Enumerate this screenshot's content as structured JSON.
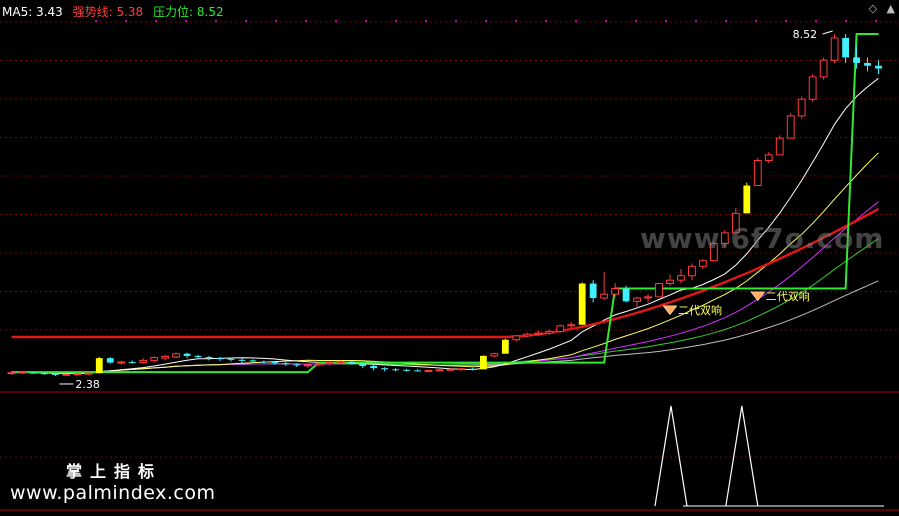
{
  "legend": {
    "ma5_label": "MA5: 3.43",
    "strong_label": "强势线: 5.38",
    "pressure_label": "压力位: 8.52"
  },
  "controls": {
    "diamond": "◇",
    "up": "▲"
  },
  "price_labels": {
    "high": "8.52",
    "low": "2.38"
  },
  "signal_label": "二代双响",
  "watermark": "www.6f7o.com",
  "footer": {
    "chinese": "掌上指标",
    "site": "www.palmindex.com"
  },
  "colors": {
    "up": "#ff3b3b",
    "down": "#3ff0ff",
    "limit_up": "#ffff00",
    "strong": "#e01818",
    "pressure": "#33e833",
    "ma_white": "#ffffff",
    "ma_yellow": "#ffff66",
    "ma_magenta": "#d030ff",
    "ma_green": "#33cc33",
    "ma_gray": "#c0c0c0",
    "grid": "#7a0000",
    "dots": "#c000c0"
  },
  "chart_data": {
    "type": "candlestick",
    "series_count": 80,
    "y_range": [
      2.2,
      8.7
    ],
    "candles": [
      [
        2.44,
        2.46,
        2.4,
        2.44
      ],
      [
        2.45,
        2.46,
        2.42,
        2.45
      ],
      [
        2.44,
        2.45,
        2.42,
        2.43
      ],
      [
        2.43,
        2.44,
        2.4,
        2.42
      ],
      [
        2.42,
        2.43,
        2.38,
        2.4
      ],
      [
        2.4,
        2.42,
        2.38,
        2.41
      ],
      [
        2.41,
        2.43,
        2.39,
        2.42
      ],
      [
        2.42,
        2.44,
        2.4,
        2.43
      ],
      [
        2.43,
        2.72,
        2.43,
        2.7
      ],
      [
        2.7,
        2.72,
        2.6,
        2.62
      ],
      [
        2.62,
        2.65,
        2.58,
        2.63
      ],
      [
        2.63,
        2.66,
        2.6,
        2.62
      ],
      [
        2.62,
        2.7,
        2.6,
        2.66
      ],
      [
        2.66,
        2.73,
        2.62,
        2.71
      ],
      [
        2.7,
        2.76,
        2.66,
        2.73
      ],
      [
        2.72,
        2.8,
        2.7,
        2.78
      ],
      [
        2.78,
        2.8,
        2.7,
        2.74
      ],
      [
        2.74,
        2.76,
        2.68,
        2.72
      ],
      [
        2.72,
        2.74,
        2.66,
        2.7
      ],
      [
        2.7,
        2.72,
        2.65,
        2.69
      ],
      [
        2.69,
        2.71,
        2.64,
        2.67
      ],
      [
        2.67,
        2.7,
        2.62,
        2.66
      ],
      [
        2.66,
        2.68,
        2.61,
        2.64
      ],
      [
        2.64,
        2.66,
        2.6,
        2.63
      ],
      [
        2.63,
        2.65,
        2.58,
        2.61
      ],
      [
        2.61,
        2.63,
        2.56,
        2.59
      ],
      [
        2.59,
        2.61,
        2.54,
        2.57
      ],
      [
        2.57,
        2.6,
        2.53,
        2.58
      ],
      [
        2.58,
        2.62,
        2.55,
        2.6
      ],
      [
        2.6,
        2.64,
        2.57,
        2.62
      ],
      [
        2.62,
        2.66,
        2.59,
        2.64
      ],
      [
        2.64,
        2.66,
        2.58,
        2.6
      ],
      [
        2.6,
        2.62,
        2.52,
        2.56
      ],
      [
        2.56,
        2.58,
        2.48,
        2.52
      ],
      [
        2.52,
        2.54,
        2.46,
        2.5
      ],
      [
        2.5,
        2.52,
        2.46,
        2.49
      ],
      [
        2.49,
        2.51,
        2.46,
        2.48
      ],
      [
        2.48,
        2.5,
        2.46,
        2.47
      ],
      [
        2.47,
        2.49,
        2.45,
        2.48
      ],
      [
        2.48,
        2.5,
        2.46,
        2.49
      ],
      [
        2.49,
        2.51,
        2.47,
        2.5
      ],
      [
        2.5,
        2.52,
        2.48,
        2.51
      ],
      [
        2.51,
        2.53,
        2.48,
        2.5
      ],
      [
        2.5,
        2.75,
        2.5,
        2.74
      ],
      [
        2.74,
        2.8,
        2.72,
        2.78
      ],
      [
        2.78,
        3.05,
        2.78,
        3.03
      ],
      [
        3.03,
        3.12,
        3.0,
        3.1
      ],
      [
        3.1,
        3.16,
        3.08,
        3.13
      ],
      [
        3.13,
        3.2,
        3.1,
        3.15
      ],
      [
        3.15,
        3.22,
        3.12,
        3.18
      ],
      [
        3.18,
        3.3,
        3.16,
        3.28
      ],
      [
        3.28,
        3.35,
        3.24,
        3.3
      ],
      [
        3.3,
        4.06,
        3.3,
        4.04
      ],
      [
        4.04,
        4.1,
        3.7,
        3.78
      ],
      [
        3.78,
        4.25,
        3.75,
        3.85
      ],
      [
        3.85,
        4.05,
        3.8,
        3.95
      ],
      [
        3.95,
        4.0,
        3.7,
        3.72
      ],
      [
        3.72,
        3.8,
        3.6,
        3.78
      ],
      [
        3.78,
        3.85,
        3.7,
        3.8
      ],
      [
        3.8,
        4.05,
        3.8,
        4.04
      ],
      [
        4.04,
        4.2,
        4.0,
        4.1
      ],
      [
        4.1,
        4.3,
        4.05,
        4.18
      ],
      [
        4.18,
        4.4,
        4.1,
        4.35
      ],
      [
        4.35,
        4.48,
        4.3,
        4.45
      ],
      [
        4.45,
        4.8,
        4.45,
        4.76
      ],
      [
        4.76,
        5.0,
        4.7,
        4.95
      ],
      [
        4.95,
        5.4,
        4.95,
        5.3
      ],
      [
        5.3,
        5.85,
        5.3,
        5.8
      ],
      [
        5.8,
        6.3,
        5.8,
        6.25
      ],
      [
        6.25,
        6.4,
        6.2,
        6.35
      ],
      [
        6.35,
        6.7,
        6.35,
        6.65
      ],
      [
        6.65,
        7.1,
        6.65,
        7.05
      ],
      [
        7.05,
        7.4,
        7.0,
        7.35
      ],
      [
        7.35,
        7.8,
        7.3,
        7.75
      ],
      [
        7.75,
        8.1,
        7.7,
        8.05
      ],
      [
        8.05,
        8.52,
        8.0,
        8.45
      ],
      [
        8.45,
        8.52,
        8.0,
        8.1
      ],
      [
        8.1,
        8.3,
        7.9,
        8.0
      ],
      [
        8.0,
        8.1,
        7.85,
        7.95
      ],
      [
        7.95,
        8.05,
        7.8,
        7.9
      ]
    ],
    "ma5_last": 3.43,
    "strong_last": 5.38,
    "pressure_last": 8.52,
    "signals": [
      "二代双响",
      "二代双响"
    ],
    "high": 8.52,
    "low": 2.38
  }
}
